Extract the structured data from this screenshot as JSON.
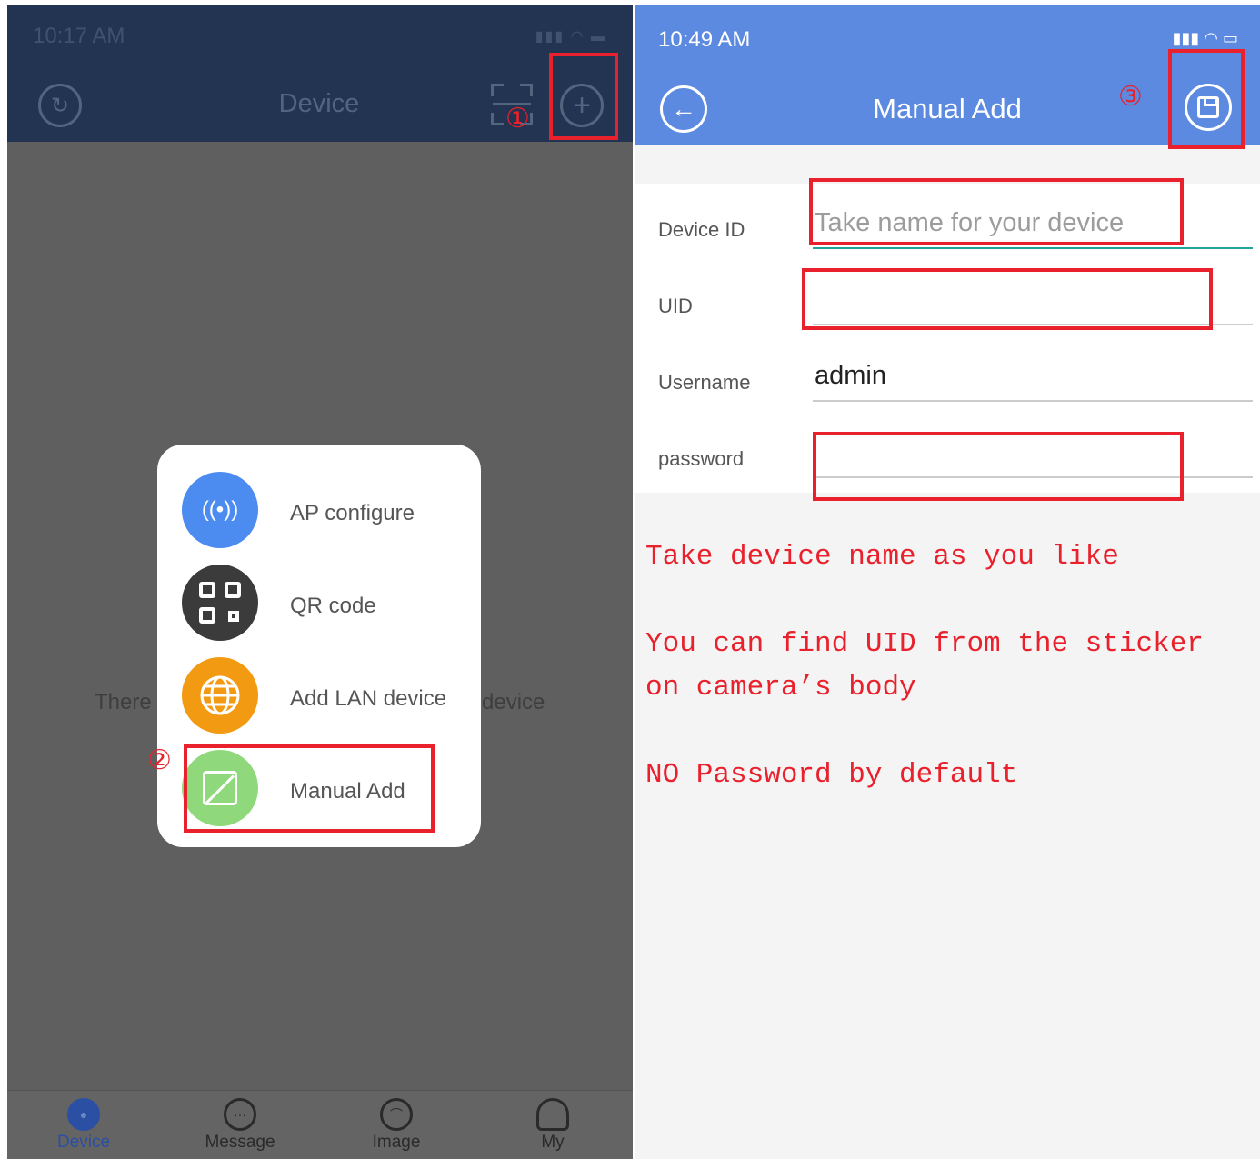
{
  "left_screen": {
    "status_time": "10:17 AM",
    "title": "Device",
    "callout_1": "①",
    "callout_2": "②",
    "empty_message_left": "There",
    "empty_message_right": "device",
    "menu": [
      {
        "label": "AP configure",
        "icon": "wifi-broadcast-icon",
        "color": "#4c8cf0",
        "glyph": "((•))"
      },
      {
        "label": "QR code",
        "icon": "qr-code-icon",
        "color": "#3b3b3b"
      },
      {
        "label": "Add LAN device",
        "icon": "globe-icon",
        "color": "#f39a13",
        "glyph": "🌐"
      },
      {
        "label": "Manual Add",
        "icon": "edit-icon",
        "color": "#8fd87b"
      }
    ],
    "tabs": [
      {
        "label": "Device",
        "icon": "device-icon",
        "active": true
      },
      {
        "label": "Message",
        "icon": "message-icon",
        "active": false
      },
      {
        "label": "Image",
        "icon": "image-icon",
        "active": false
      },
      {
        "label": "My",
        "icon": "user-icon",
        "active": false
      }
    ]
  },
  "right_screen": {
    "status_time": "10:49  AM",
    "title": "Manual Add",
    "callout_3": "③",
    "fields": [
      {
        "label": "Device ID",
        "value": "",
        "placeholder": "Take name for your device"
      },
      {
        "label": "UID",
        "value": "",
        "placeholder": ""
      },
      {
        "label": "Username",
        "value": "admin",
        "placeholder": ""
      },
      {
        "label": "password",
        "value": "",
        "placeholder": ""
      }
    ],
    "notes": [
      "Take device name as you like",
      "You can find UID from the sticker on camera’s body",
      "NO Password by default"
    ]
  },
  "colors": {
    "header_blue": "#5c8ae0",
    "annotation_red": "#e8212c",
    "dark_header": "#233452"
  }
}
